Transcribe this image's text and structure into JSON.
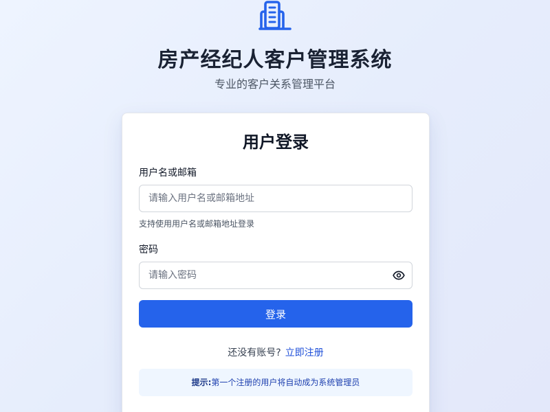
{
  "header": {
    "logo_icon": "building-icon",
    "title": "房产经纪人客户管理系统",
    "subtitle": "专业的客户关系管理平台"
  },
  "login": {
    "title": "用户登录",
    "username": {
      "label": "用户名或邮箱",
      "placeholder": "请输入用户名或邮箱地址",
      "value": "",
      "hint": "支持使用用户名或邮箱地址登录"
    },
    "password": {
      "label": "密码",
      "placeholder": "请输入密码",
      "value": "",
      "toggle_icon": "eye-icon"
    },
    "submit_label": "登录",
    "register_prompt": "还没有账号?",
    "register_link": "立即注册",
    "tip": {
      "prefix": "提示:",
      "text": "第一个注册的用户将自动成为系统管理员"
    }
  },
  "colors": {
    "accent": "#2563eb",
    "link": "#1d4ed8",
    "tip_background": "#eff6ff"
  }
}
